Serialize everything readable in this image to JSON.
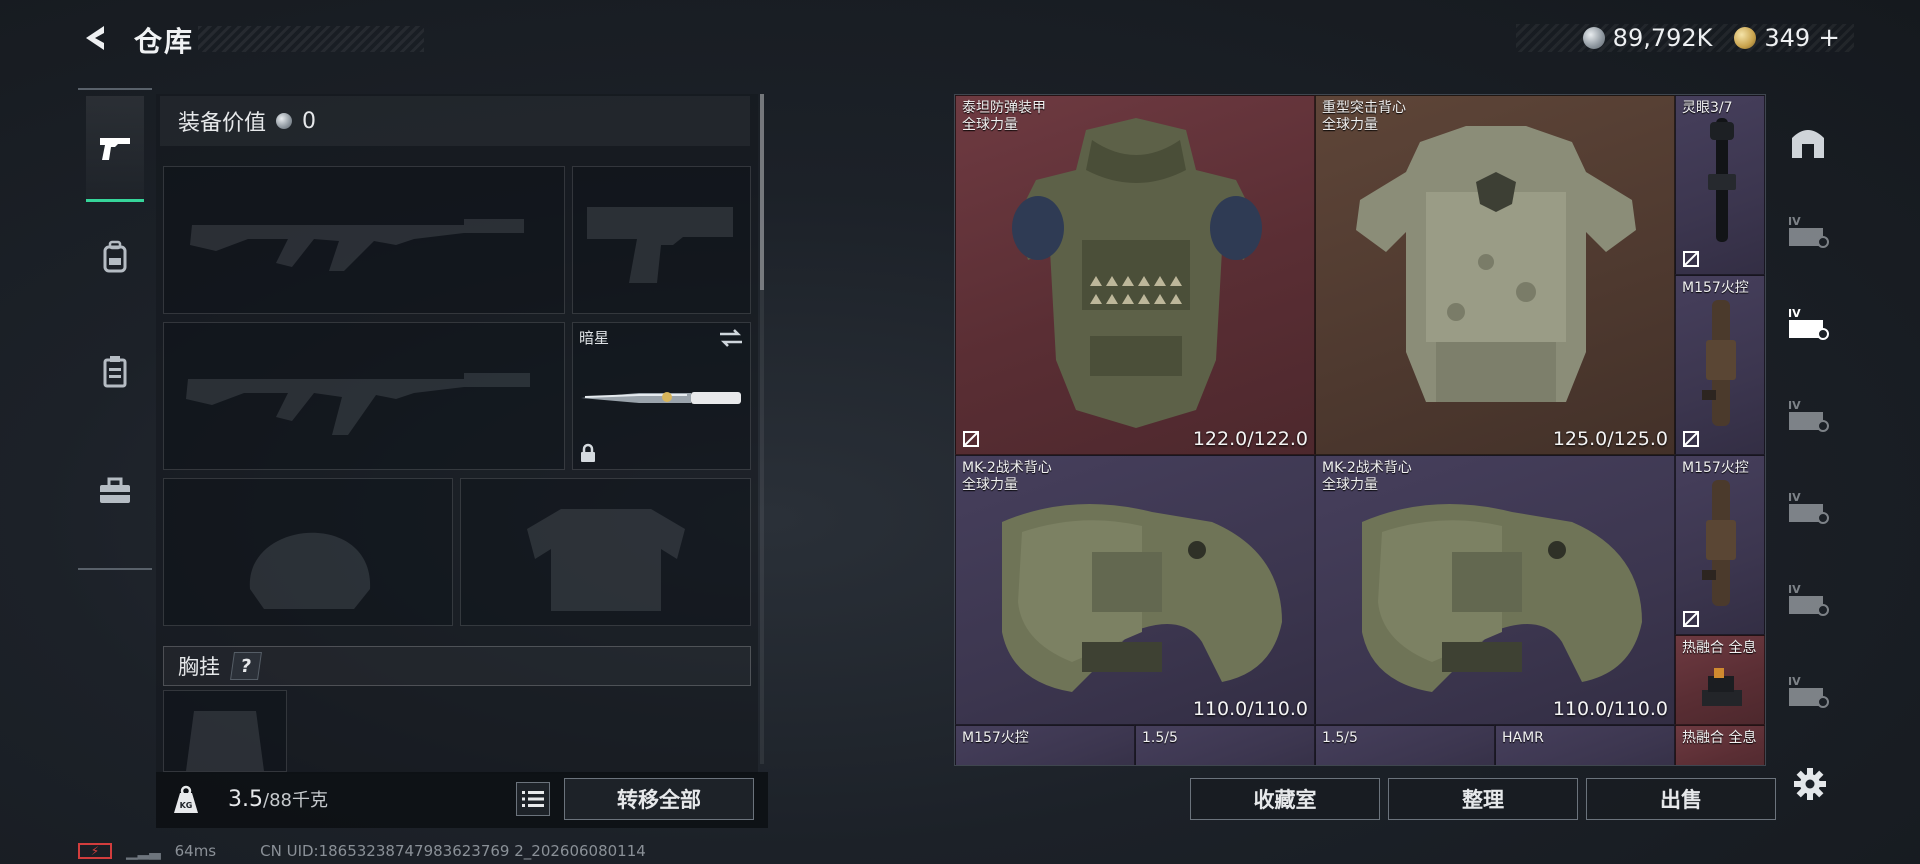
{
  "header": {
    "title": "仓库",
    "currency_silver": "89,792K",
    "currency_gold": "349",
    "add_label": "+"
  },
  "rail": {
    "items": [
      "weapon-icon",
      "backpack-icon",
      "chest-rig-icon",
      "toolbox-icon"
    ],
    "active_index": 0
  },
  "loadout": {
    "equip_value_label": "装备价值",
    "equip_value": "0",
    "melee_slot_name": "暗星",
    "chest_rig_label": "胸挂",
    "help_label": "?",
    "weight_current": "3.5",
    "weight_max": "/88千克",
    "transfer_all_label": "转移全部"
  },
  "inventory": {
    "items": [
      {
        "name": "泰坦防弹装甲",
        "sub": "全球力量",
        "durability": "122.0/122.0",
        "rarity": "red"
      },
      {
        "name": "重型突击背心",
        "sub": "全球力量",
        "durability": "125.0/125.0",
        "rarity": "brown"
      },
      {
        "name": "灵眼3/7",
        "sub": "",
        "durability": "",
        "rarity": "purple"
      },
      {
        "name": "M157火控",
        "sub": "",
        "durability": "",
        "rarity": "purple"
      },
      {
        "name": "MK-2战术背心",
        "sub": "全球力量",
        "durability": "110.0/110.0",
        "rarity": "purple"
      },
      {
        "name": "MK-2战术背心",
        "sub": "全球力量",
        "durability": "110.0/110.0",
        "rarity": "purple"
      },
      {
        "name": "M157火控",
        "sub": "",
        "durability": "",
        "rarity": "purple"
      },
      {
        "name": "热融合 全息",
        "sub": "",
        "durability": "",
        "rarity": "red"
      },
      {
        "name": "M157火控",
        "sub": "",
        "durability": "",
        "rarity": "purple"
      },
      {
        "name": "1.5/5",
        "sub": "",
        "durability": "",
        "rarity": "purple"
      },
      {
        "name": "1.5/5",
        "sub": "",
        "durability": "",
        "rarity": "purple"
      },
      {
        "name": "HAMR",
        "sub": "",
        "durability": "",
        "rarity": "purple"
      },
      {
        "name": "热融合 全息",
        "sub": "",
        "durability": "",
        "rarity": "red"
      }
    ]
  },
  "side_rail": {
    "items": [
      "vault-icon",
      "storage-tab-1-icon",
      "storage-tab-2-icon",
      "storage-tab-3-icon",
      "storage-tab-4-icon",
      "storage-tab-5-icon",
      "storage-tab-6-icon"
    ],
    "tab_numeral": "IV",
    "active_index": 2
  },
  "actions": {
    "collection_label": "收藏室",
    "organize_label": "整理",
    "sell_label": "出售"
  },
  "status": {
    "ping": "64ms",
    "uid": "CN UID:18653238747983623769 2_202606080114"
  },
  "colors": {
    "accent_green": "#36d59a",
    "rarity_red": "#6e3a41",
    "rarity_brown": "#5e4538",
    "rarity_purple": "#463f5c"
  }
}
